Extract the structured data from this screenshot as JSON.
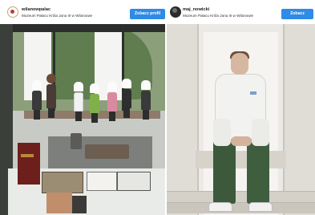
{
  "posts": [
    {
      "username": "wilanowpalac",
      "location": "Muzeum Pałacu Króla Jana III w Wilanowie",
      "button_label": "Zobacz profil",
      "avatar": "palace-logo-avatar"
    },
    {
      "username": "maj_nowicki",
      "location": "Muzeum Pałacu Króla Jana III w Wilanowie",
      "button_label": "Zobacz profil",
      "avatar": "person-avatar"
    }
  ],
  "colors": {
    "button_bg": "#2f8be6",
    "button_text": "#ffffff",
    "username_text": "#1b1b1b"
  }
}
